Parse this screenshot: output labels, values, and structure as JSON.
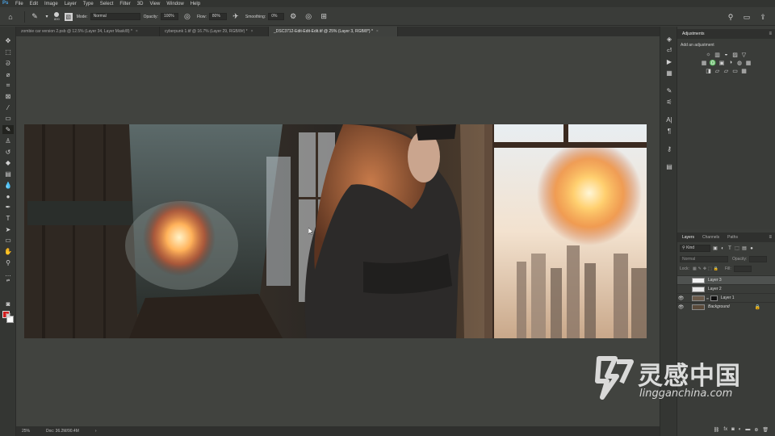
{
  "menubar": {
    "app_icon": "photoshop-logo-icon",
    "items": [
      "File",
      "Edit",
      "Image",
      "Layer",
      "Type",
      "Select",
      "Filter",
      "3D",
      "View",
      "Window",
      "Help"
    ]
  },
  "options_bar": {
    "brush_size": "800",
    "mode_label": "Mode:",
    "mode_value": "Normal",
    "opacity_label": "Opacity:",
    "opacity_value": "100%",
    "flow_label": "Flow:",
    "flow_value": "80%",
    "smoothing_label": "Smoothing:",
    "smoothing_value": "0%"
  },
  "doc_tabs": [
    {
      "label": "zombie car version 2.psb @ 12.5% (Layer 34, Layer Mask/8) *",
      "active": false
    },
    {
      "label": "cyberpunk 1.tif @ 16.7% (Layer 29, RGB/8#) *",
      "active": false
    },
    {
      "label": "_DSC3712-Edit-Edit-Edit.tif @ 25% (Layer 3, RGB/8*) *",
      "active": true
    }
  ],
  "status_bar": {
    "zoom": "25%",
    "doc_info": "Doc: 36.2M/90.4M"
  },
  "adjustments": {
    "tab_label": "Adjustments",
    "hint": "Add an adjustment",
    "row1": [
      "☼",
      "▥",
      "◒",
      "▨",
      "▽"
    ],
    "row2": [
      "▦",
      "♎",
      "▣",
      "◑",
      "◍",
      "▦"
    ],
    "row3": [
      "◨",
      "▱",
      "▱",
      "▭",
      "▦"
    ]
  },
  "layers_panel": {
    "tabs": [
      "Layers",
      "Channels",
      "Paths"
    ],
    "filter_kind": "Kind",
    "blend_mode": "Normal",
    "opacity_label": "Opacity:",
    "lock_label": "Lock:",
    "fill_label": "Fill:",
    "layers": [
      {
        "name": "Layer 3",
        "visible": false,
        "selected": true,
        "thumb": "#f2f2f2"
      },
      {
        "name": "Layer 2",
        "visible": false,
        "selected": false,
        "thumb": "#e8e8e8"
      },
      {
        "name": "Layer 1",
        "visible": true,
        "selected": false,
        "thumb": "#6b5a4a",
        "has_mask": true
      },
      {
        "name": "Background",
        "visible": true,
        "selected": false,
        "thumb": "#5a4a3a",
        "locked": true
      }
    ]
  },
  "watermark": {
    "cn": "灵感中国",
    "url": "lingganchina.com"
  },
  "colors": {
    "foreground": "#d11a1a",
    "background": "#ffffff",
    "ui_dark": "#323431",
    "canvas_bg": "#41433f"
  }
}
